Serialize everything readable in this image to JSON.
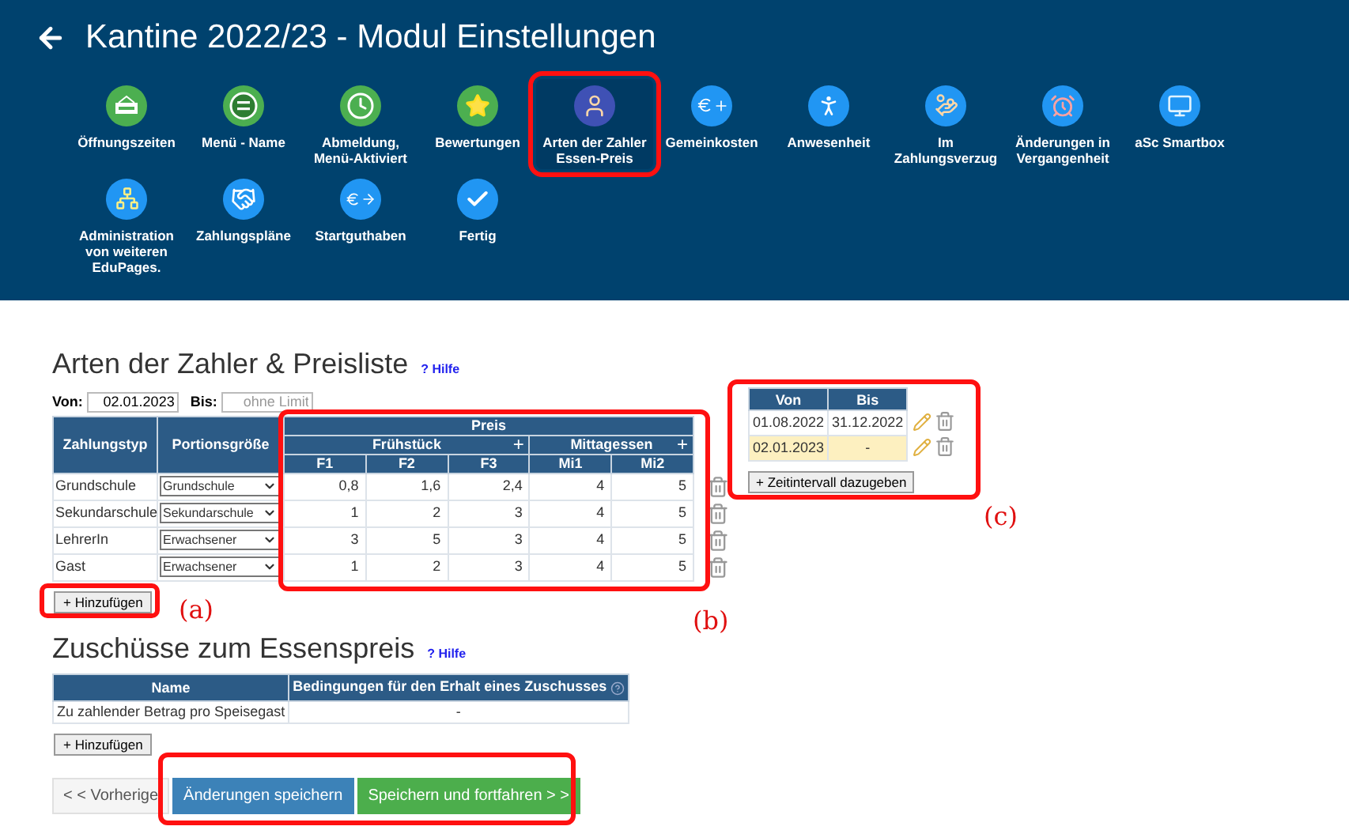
{
  "header": {
    "title": "Kantine 2022/23 - Modul Einstellungen",
    "modules": [
      {
        "label": "Öffnungszeiten",
        "kind": "open-sign",
        "color": "#4caf50",
        "selected": false
      },
      {
        "label": "Menü - Name",
        "kind": "board",
        "color": "#4caf50",
        "selected": false
      },
      {
        "label": "Abmeldung, Menü-Aktiviert",
        "kind": "clock",
        "color": "#4caf50",
        "selected": false
      },
      {
        "label": "Bewertungen",
        "kind": "star",
        "color": "#4caf50",
        "selected": false
      },
      {
        "label": "Arten der Zahler Essen-Preis",
        "kind": "person",
        "color": "#3f51b5",
        "selected": true
      },
      {
        "label": "Gemeinkosten",
        "kind": "euro-plus",
        "color": "#2196f3",
        "selected": false
      },
      {
        "label": "Anwesenheit",
        "kind": "walk",
        "color": "#2196f3",
        "selected": false
      },
      {
        "label": "Im Zahlungsverzug",
        "kind": "bag",
        "color": "#2196f3",
        "selected": false
      },
      {
        "label": "Änderungen in Vergangenheit",
        "kind": "alarm",
        "color": "#2196f3",
        "selected": false
      },
      {
        "label": "aSc Smartbox",
        "kind": "monitor",
        "color": "#2196f3",
        "selected": false
      },
      {
        "label": "Administration von weiteren EduPages.",
        "kind": "network",
        "color": "#2196f3",
        "selected": false
      },
      {
        "label": "Zahlungspläne",
        "kind": "handshake",
        "color": "#2196f3",
        "selected": false
      },
      {
        "label": "Startguthaben",
        "kind": "euro-arrow",
        "color": "#2196f3",
        "selected": false
      },
      {
        "label": "Fertig",
        "kind": "check",
        "color": "#2196f3",
        "selected": false
      }
    ]
  },
  "prices": {
    "title": "Arten der Zahler & Preisliste",
    "help": "? Hilfe",
    "von_label": "Von:",
    "von_value": "02.01.2023",
    "bis_label": "Bis:",
    "bis_placeholder": "ohne Limit",
    "columns": {
      "type": "Zahlungstyp",
      "portion": "Portionsgröße",
      "price": "Preis",
      "groups": [
        {
          "name": "Frühstück",
          "add": "+",
          "sub": [
            "F1",
            "F2",
            "F3"
          ]
        },
        {
          "name": "Mittagessen",
          "add": "+",
          "sub": [
            "Mi1",
            "Mi2"
          ]
        }
      ]
    },
    "rows": [
      {
        "type": "Grundschule",
        "portion": "Grundschule",
        "prices": [
          "0,8",
          "1,6",
          "2,4",
          "4",
          "5"
        ]
      },
      {
        "type": "Sekundarschule",
        "portion": "Sekundarschule",
        "prices": [
          "1",
          "2",
          "3",
          "4",
          "5"
        ]
      },
      {
        "type": "LehrerIn",
        "portion": "Erwachsener",
        "prices": [
          "3",
          "5",
          "3",
          "4",
          "5"
        ]
      },
      {
        "type": "Gast",
        "portion": "Erwachsener",
        "prices": [
          "1",
          "2",
          "3",
          "4",
          "5"
        ]
      }
    ],
    "add_button": "+ Hinzufügen"
  },
  "intervals": {
    "columns": [
      "Von",
      "Bis"
    ],
    "rows": [
      {
        "von": "01.08.2022",
        "bis": "31.12.2022",
        "selected": false
      },
      {
        "von": "02.01.2023",
        "bis": "-",
        "selected": true
      }
    ],
    "add_button": "+ Zeitintervall dazugeben"
  },
  "subsidies": {
    "title": "Zuschüsse zum Essenspreis",
    "help": "? Hilfe",
    "columns": [
      "Name",
      "Bedingungen für den Erhalt eines Zuschusses"
    ],
    "rows": [
      [
        "Zu zahlender Betrag pro Speisegast",
        "-"
      ]
    ],
    "add_button": "+ Hinzufügen"
  },
  "footer": {
    "previous": "< < Vorherige",
    "save": "Änderungen speichern",
    "save_continue": "Speichern und fortfahren > >"
  },
  "annotations": [
    "(a)",
    "(b)",
    "(c)"
  ]
}
